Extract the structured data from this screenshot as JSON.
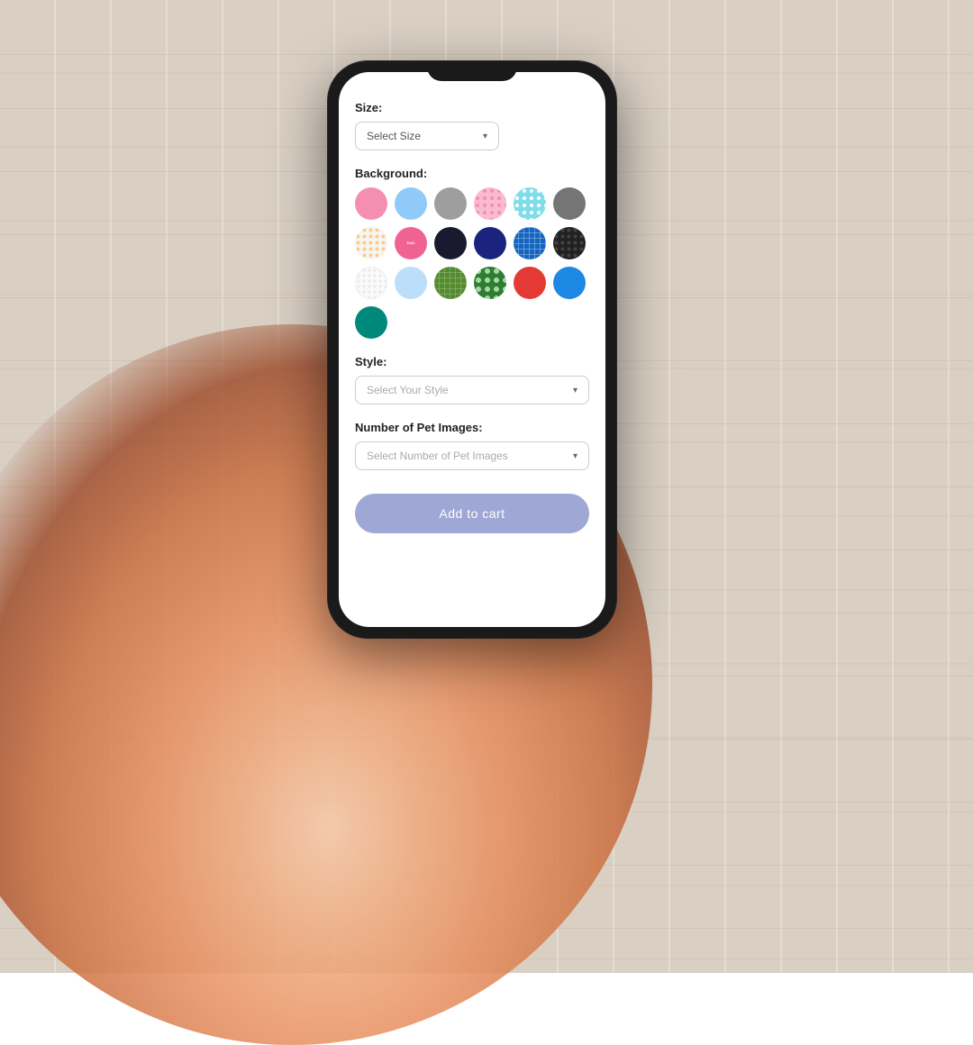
{
  "background": {
    "color": "#d5c9bb"
  },
  "phone": {
    "screen": {
      "size_label": "Size:",
      "size_placeholder": "Select Size",
      "background_label": "Background:",
      "style_label": "Style:",
      "style_placeholder": "Select Your Style",
      "num_images_label": "Number of Pet Images:",
      "num_images_placeholder": "Select Number of Pet Images",
      "add_to_cart": "Add to cart"
    },
    "circles": [
      {
        "id": "pink",
        "class": "circle-pink"
      },
      {
        "id": "light-blue",
        "class": "circle-light-blue"
      },
      {
        "id": "gray",
        "class": "circle-gray"
      },
      {
        "id": "pink-pattern",
        "class": "circle-pink-pattern"
      },
      {
        "id": "teal-dots",
        "class": "circle-teal-dots"
      },
      {
        "id": "dark-gray",
        "class": "circle-dark-gray"
      },
      {
        "id": "white-dots",
        "class": "circle-white-dots"
      },
      {
        "id": "pink-text",
        "class": "circle-pink-text"
      },
      {
        "id": "dark-pattern",
        "class": "circle-dark-pattern"
      },
      {
        "id": "navy",
        "class": "circle-navy"
      },
      {
        "id": "plaid-blue",
        "class": "circle-plaid-blue"
      },
      {
        "id": "dark-dots",
        "class": "circle-dark-dots"
      },
      {
        "id": "white-small-dots",
        "class": "circle-white-small-dots"
      },
      {
        "id": "light-blue-soft",
        "class": "circle-light-blue-soft"
      },
      {
        "id": "plaid-green",
        "class": "circle-plaid-green"
      },
      {
        "id": "dark-green-floral",
        "class": "circle-dark-green-floral"
      },
      {
        "id": "red",
        "class": "circle-red"
      },
      {
        "id": "steel-blue",
        "class": "circle-steel-blue"
      },
      {
        "id": "teal",
        "class": "circle-teal"
      }
    ]
  }
}
